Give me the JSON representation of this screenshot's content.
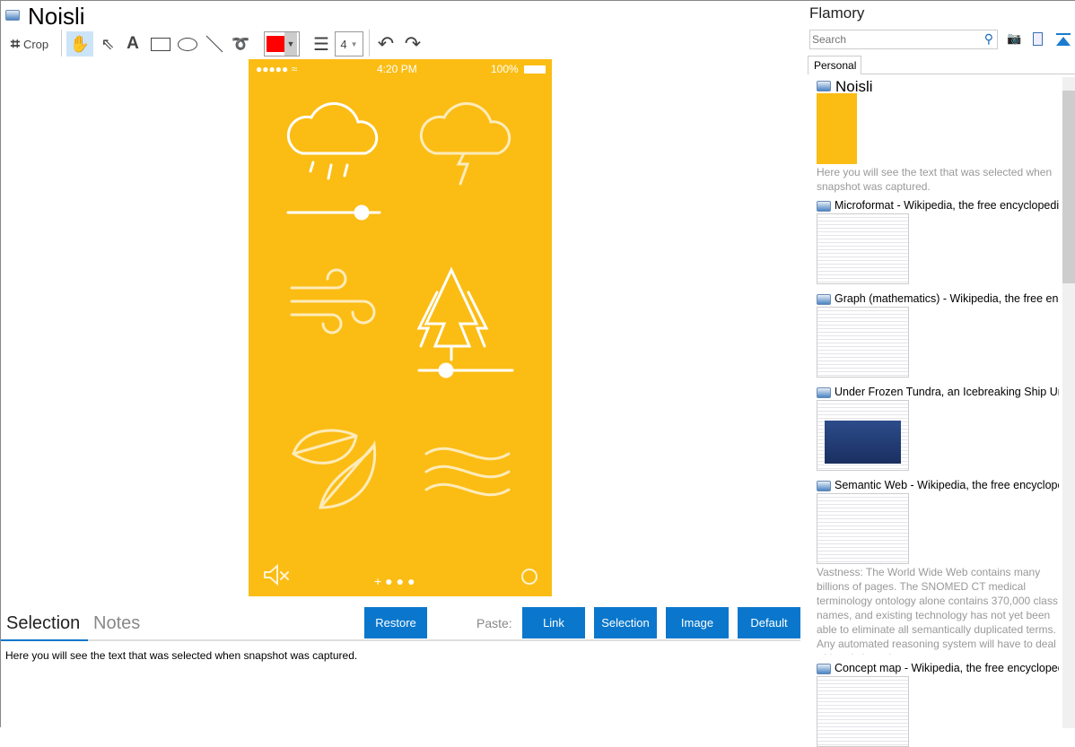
{
  "window": {
    "title": "Noisli"
  },
  "toolbar": {
    "crop_label": "Crop",
    "line_width": "4",
    "color": "#ff0000"
  },
  "phone": {
    "time": "4:20 PM",
    "battery": "100%",
    "bg": "#fbbd14"
  },
  "bottom": {
    "tabs": [
      "Selection",
      "Notes"
    ],
    "restore": "Restore",
    "paste_label": "Paste:",
    "paste_buttons": [
      "Link",
      "Selection",
      "Image",
      "Default"
    ],
    "selection_text": "Here you will see the text that was selected when snapshot was captured."
  },
  "sidebar": {
    "title": "Flamory",
    "search_placeholder": "Search",
    "tab": "Personal",
    "items": [
      {
        "title": "Noisli",
        "desc": "Here you will see the text that was selected when snapshot was captured."
      },
      {
        "title": "Microformat - Wikipedia, the free encyclopedia"
      },
      {
        "title": "Graph (mathematics) - Wikipedia, the free encyclopedia"
      },
      {
        "title": "Under Frozen Tundra, an Icebreaking Ship Uncovers"
      },
      {
        "title": "Semantic Web - Wikipedia, the free encyclopedia",
        "desc": "Vastness: The World Wide Web contains many billions of pages. The SNOMED CT medical terminology ontology alone contains 370,000 class names, and existing technology has not yet been able to eliminate all semantically duplicated terms. Any automated reasoning system will have to deal with truly huge inputs."
      },
      {
        "title": "Concept map - Wikipedia, the free encyclopedia"
      }
    ]
  }
}
